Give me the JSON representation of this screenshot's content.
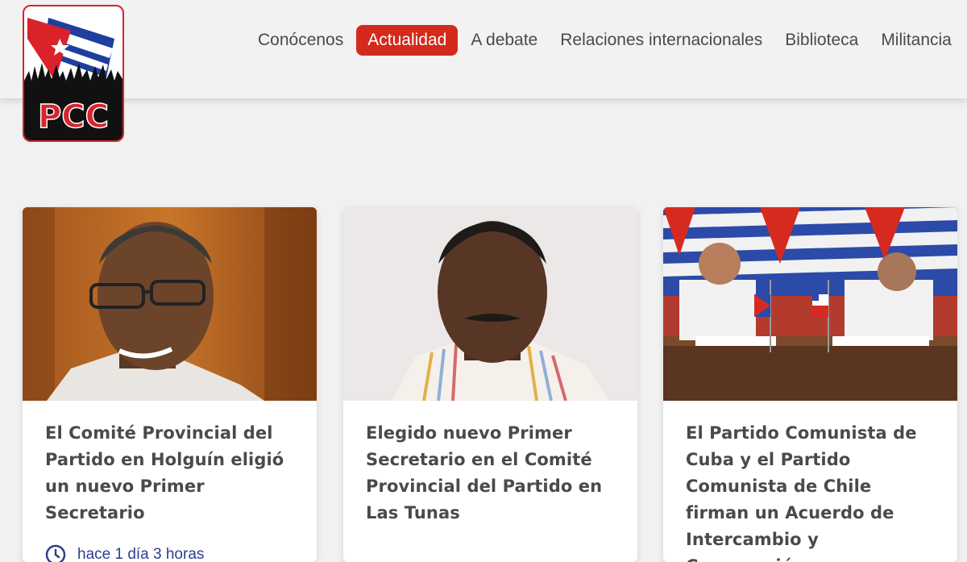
{
  "logo": {
    "text": "PCC",
    "icon": "pcc-logo-icon"
  },
  "nav": {
    "items": [
      {
        "label": "Conócenos"
      },
      {
        "label": "Actualidad"
      },
      {
        "label": "A debate"
      },
      {
        "label": "Relaciones internacionales"
      },
      {
        "label": "Biblioteca"
      },
      {
        "label": "Militancia"
      }
    ],
    "active_index": 1
  },
  "colors": {
    "accent": "#d32a1c",
    "time_text": "#2b3f8c",
    "title_text": "#4a4a4a"
  },
  "articles": [
    {
      "title": "El Comité Provincial del Partido en Holguín eligió un nuevo Primer Secretario",
      "time": "hace 1 día 3 horas",
      "icon": "clock-icon"
    },
    {
      "title": "Elegido nuevo Primer Secretario en el Comité Provincial del Partido en Las Tunas"
    },
    {
      "title": "El Partido Comunista de Cuba y el Partido Comunista de Chile firman un Acuerdo de Intercambio y Cooperación"
    }
  ]
}
